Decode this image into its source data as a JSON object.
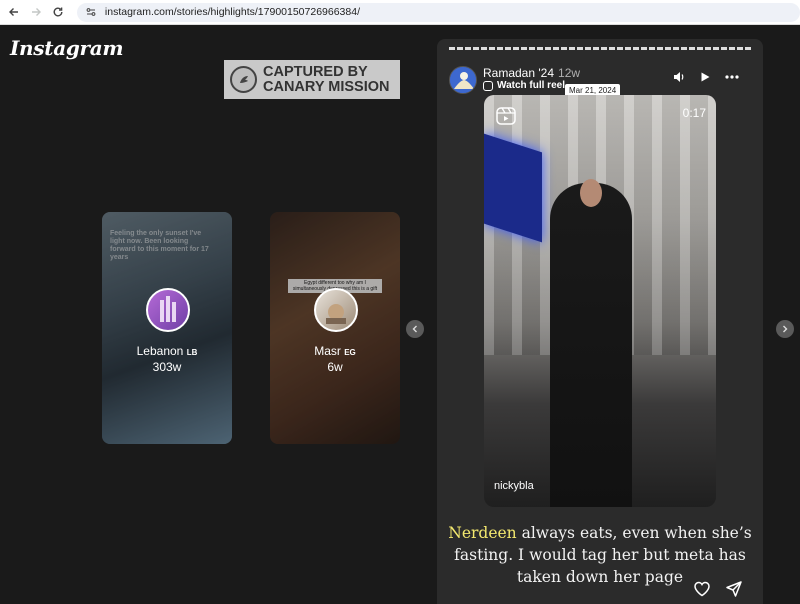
{
  "browser": {
    "url": "instagram.com/stories/highlights/17900150726966384/"
  },
  "app": {
    "logo": "Instagram"
  },
  "watermark": {
    "line1": "CAPTURED BY",
    "line2": "CANARY MISSION"
  },
  "highlights": [
    {
      "name": "Lebanon",
      "flag": "LB",
      "time": "303w",
      "overlay": "Feeling the only sunset I've light now. Been looking forward to this moment for 17 years"
    },
    {
      "name": "Masr",
      "flag": "EG",
      "time": "6w",
      "overlay": "Egypt different too why am I simultaneously depressed this is a gift"
    }
  ],
  "story": {
    "title": "Ramadan '24",
    "time": "12w",
    "reel_label": "Watch full reel",
    "tooltip_date": "Mar 21, 2024",
    "video_time": "0:17",
    "video_username": "nickybla",
    "caption_highlight": "Nerdeen",
    "caption_rest": " always eats, even when she’s fasting. I would tag her but meta has taken down her page"
  },
  "icons": {
    "back": "back-arrow-icon",
    "forward": "forward-arrow-icon",
    "reload": "reload-icon",
    "site_info": "site-info-icon",
    "sound": "speaker-icon",
    "play": "play-icon",
    "more": "more-horizontal-icon",
    "like": "heart-icon",
    "share": "send-icon",
    "prev": "chevron-left-icon",
    "next": "chevron-right-icon"
  }
}
